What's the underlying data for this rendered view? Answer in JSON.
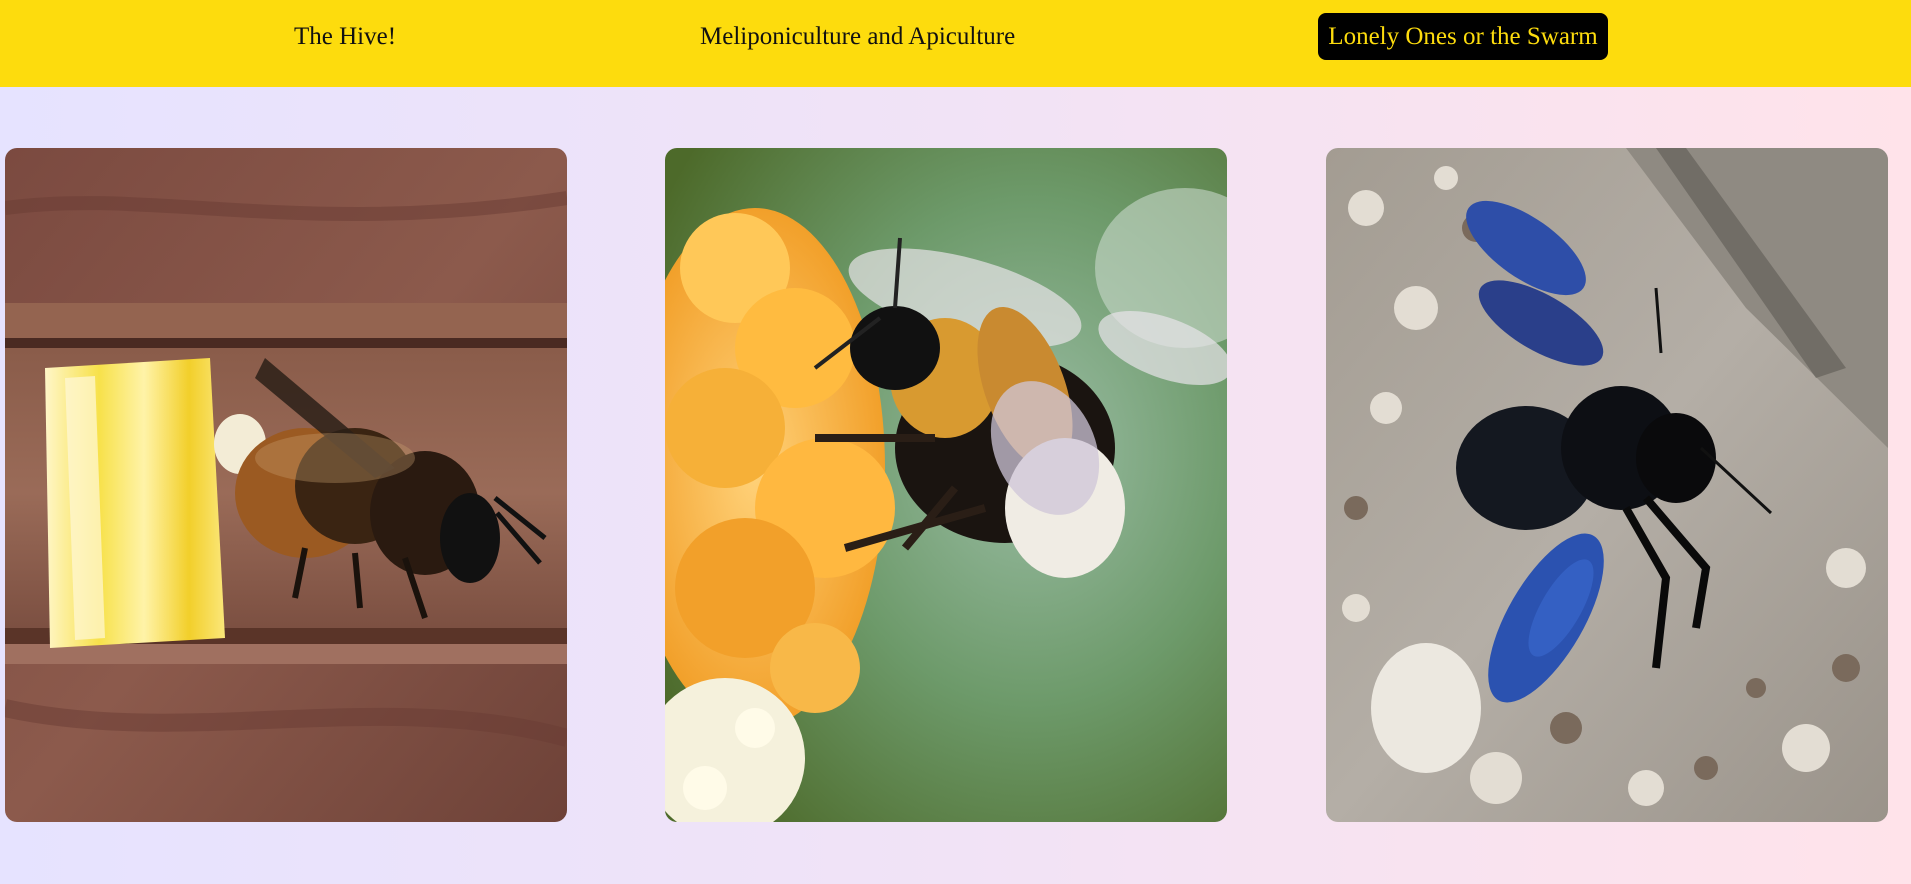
{
  "nav": {
    "links": [
      {
        "label": "The Hive!"
      },
      {
        "label": "Meliponiculture and Apiculture"
      },
      {
        "label": "Lonely Ones or the Swarm"
      }
    ],
    "active_index": 2
  },
  "gallery": {
    "images": [
      {
        "subject": "mason-bee-in-nest-tube"
      },
      {
        "subject": "bumblebee-on-orange-flower"
      },
      {
        "subject": "carpenter-bee-on-stone"
      }
    ]
  },
  "colors": {
    "navbar_bg": "#fddc0d",
    "active_bg": "#000000",
    "active_text": "#fddc0d",
    "page_gradient_start": "#e6e3ff",
    "page_gradient_end": "#ffe3ea"
  }
}
